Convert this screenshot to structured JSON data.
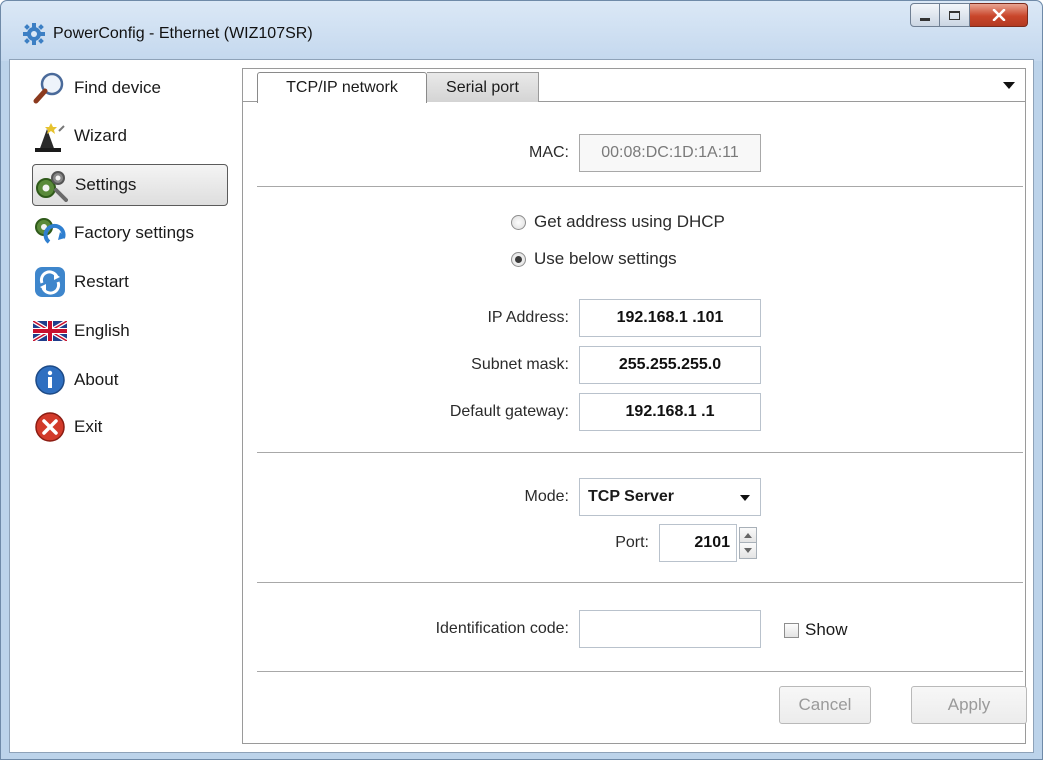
{
  "window": {
    "title": "PowerConfig - Ethernet (WIZ107SR)",
    "icon": "gear-icon"
  },
  "sidebar": {
    "items": [
      {
        "label": "Find device",
        "icon": "magnifier-icon"
      },
      {
        "label": "Wizard",
        "icon": "wizard-hat-icon"
      },
      {
        "label": "Settings",
        "icon": "gears-icon",
        "selected": true
      },
      {
        "label": "Factory settings",
        "icon": "factory-reset-icon"
      },
      {
        "label": "Restart",
        "icon": "refresh-icon"
      },
      {
        "label": "English",
        "icon": "uk-flag-icon"
      },
      {
        "label": "About",
        "icon": "info-icon"
      },
      {
        "label": "Exit",
        "icon": "exit-icon"
      }
    ]
  },
  "tabs": [
    {
      "label": "TCP/IP network",
      "active": true
    },
    {
      "label": "Serial port",
      "active": false
    }
  ],
  "network": {
    "mac_label": "MAC:",
    "mac_value": "00:08:DC:1D:1A:11",
    "dhcp_label": "Get address using DHCP",
    "static_label": "Use below settings",
    "selected_mode": "static",
    "ip_label": "IP Address:",
    "ip_value": "192.168.1 .101",
    "subnet_label": "Subnet mask:",
    "subnet_value": "255.255.255.0",
    "gateway_label": "Default gateway:",
    "gateway_value": "192.168.1 .1"
  },
  "connection": {
    "mode_label": "Mode:",
    "mode_value": "TCP Server",
    "port_label": "Port:",
    "port_value": "2101"
  },
  "identification": {
    "label": "Identification code:",
    "value": "",
    "show_label": "Show",
    "show_checked": false
  },
  "buttons": {
    "cancel": "Cancel",
    "apply": "Apply"
  },
  "colors": {
    "titlebar": "#c4d8ee",
    "close_button": "#c9462b",
    "window_frame": "#bcd3ea"
  }
}
